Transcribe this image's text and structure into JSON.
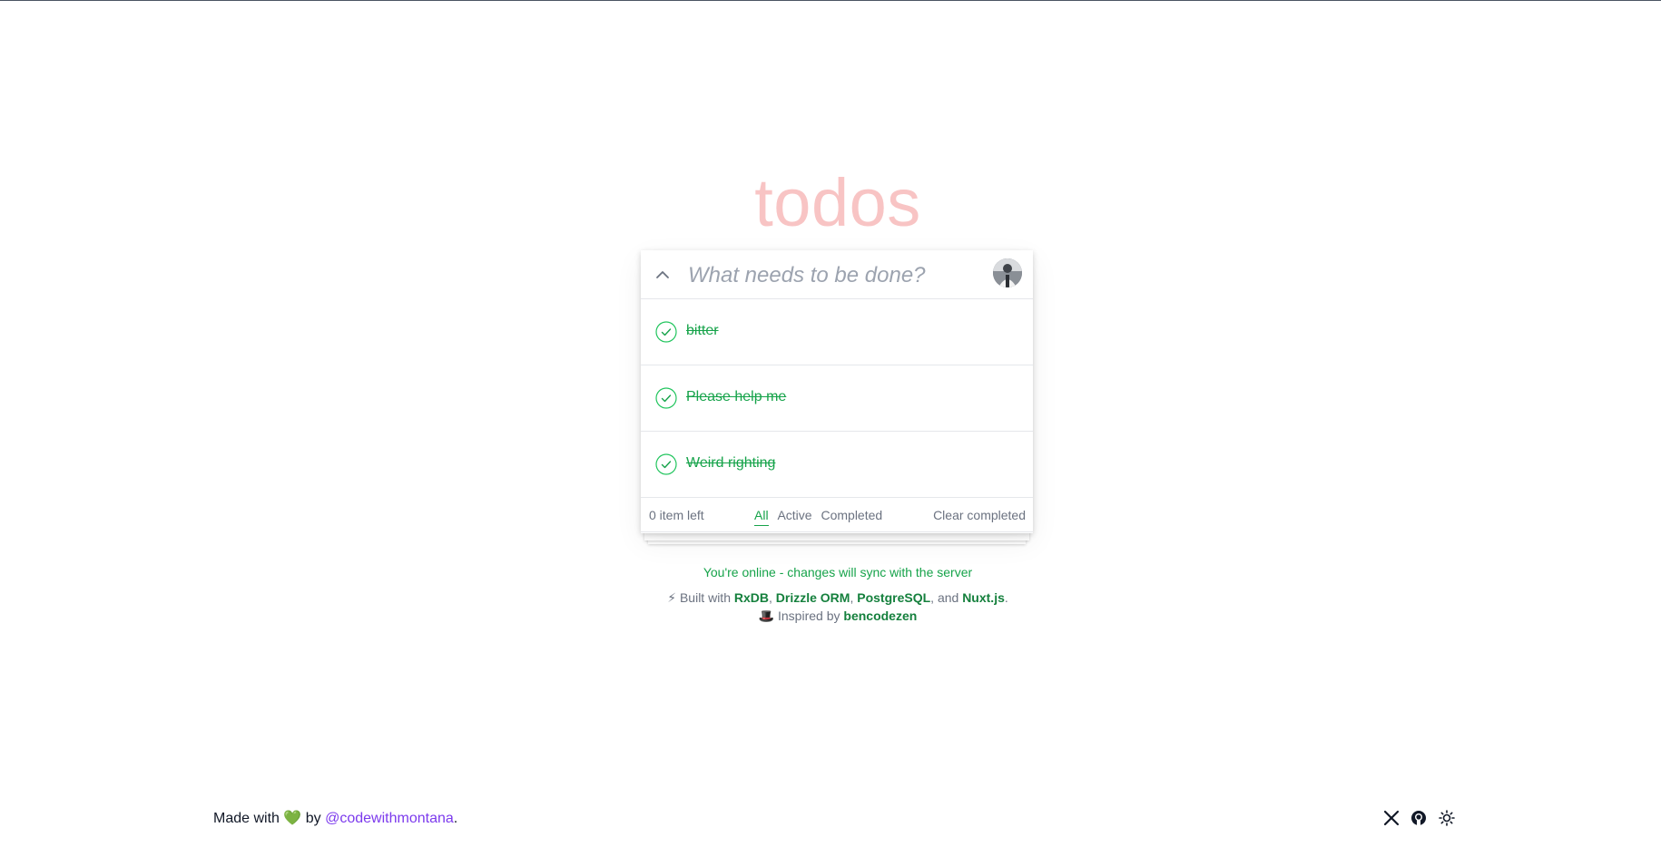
{
  "app": {
    "title": "todos"
  },
  "input": {
    "placeholder": "What needs to be done?"
  },
  "todos": [
    {
      "text": "bitter",
      "completed": true
    },
    {
      "text": "Please help me",
      "completed": true
    },
    {
      "text": "Weird righting",
      "completed": true
    }
  ],
  "footer": {
    "count_label": "0 item left",
    "filters": [
      "All",
      "Active",
      "Completed"
    ],
    "selected_filter": "All",
    "clear_label": "Clear completed"
  },
  "status": {
    "text": "You're online - changes will sync with the server"
  },
  "credits": {
    "lead": "⚡ Built with",
    "tech": [
      "RxDB",
      "Drizzle ORM",
      "PostgreSQL",
      "Nuxt.js"
    ],
    "sep": ",",
    "and": "and",
    "end": ".",
    "inspired_prefix": "🎩 Inspired by",
    "inspired_name": "bencodezen"
  },
  "page_footer": {
    "made_with": "Made with",
    "heart": "💚",
    "by": "by",
    "handle": "@codewithmontana",
    "period": "."
  },
  "icons": [
    "chevron-up-icon",
    "check-circle-icon",
    "x-logo-icon",
    "github-icon",
    "sun-icon"
  ],
  "colors": {
    "accent": "#16a34a",
    "title": "#f8c4c4",
    "handle": "#7c3aed"
  }
}
